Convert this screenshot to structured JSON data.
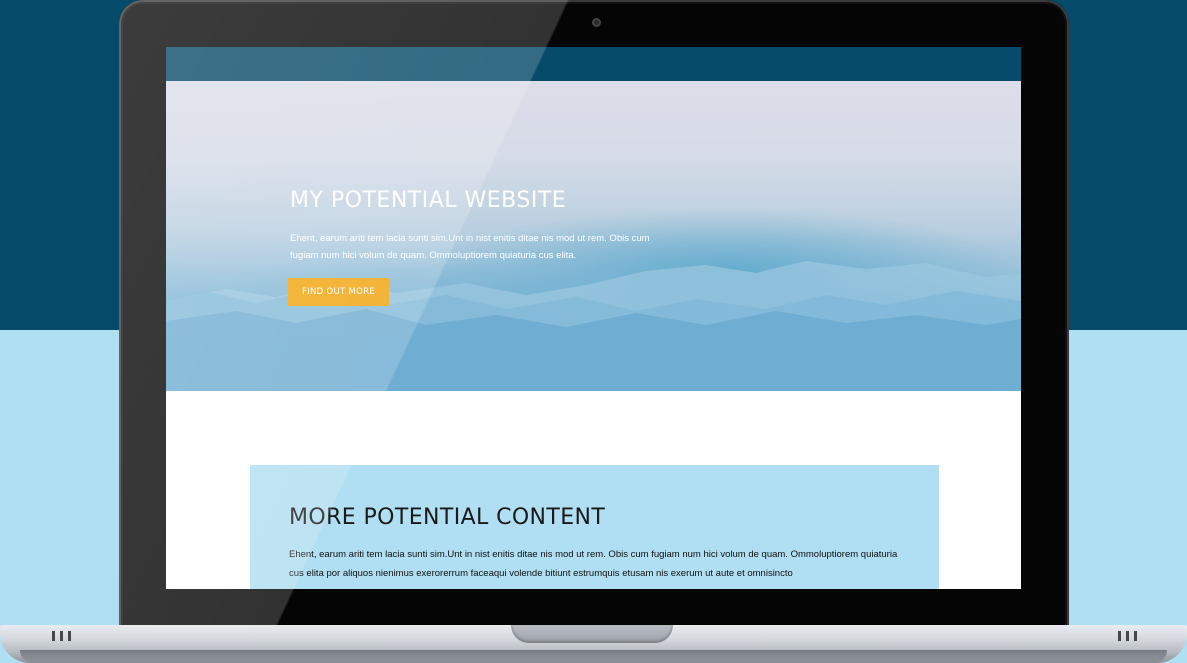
{
  "colors": {
    "background_top": "#054a68",
    "background_bottom": "#b0def2",
    "site_nav": "#054a68",
    "button": "#f0a40c",
    "content_box": "#b0def2"
  },
  "hero": {
    "title": "MY POTENTIAL WEBSITE",
    "text": "Ehent, earum ariti tem lacia sunti sim.Unt in nist enitis ditae nis mod ut rem. Obis cum fugiam num hici volum de quam. Ommoluptiorem quiaturia cus elita.",
    "button_label": "FIND OUT MORE"
  },
  "content": {
    "title": "MORE POTENTIAL CONTENT",
    "text": "Ehent, earum ariti tem lacia sunti sim.Unt in nist enitis ditae nis mod ut rem. Obis cum fugiam num hici volum de quam. Ommoluptiorem quiaturia cus elita por aliquos nienimus exerorerrum faceaqui volende bitiunt estrumquis etusam nis exerum ut aute et omnisincto"
  },
  "icons": {
    "camera": "camera-icon",
    "vent_left": "vent-icon",
    "vent_right": "vent-icon"
  }
}
